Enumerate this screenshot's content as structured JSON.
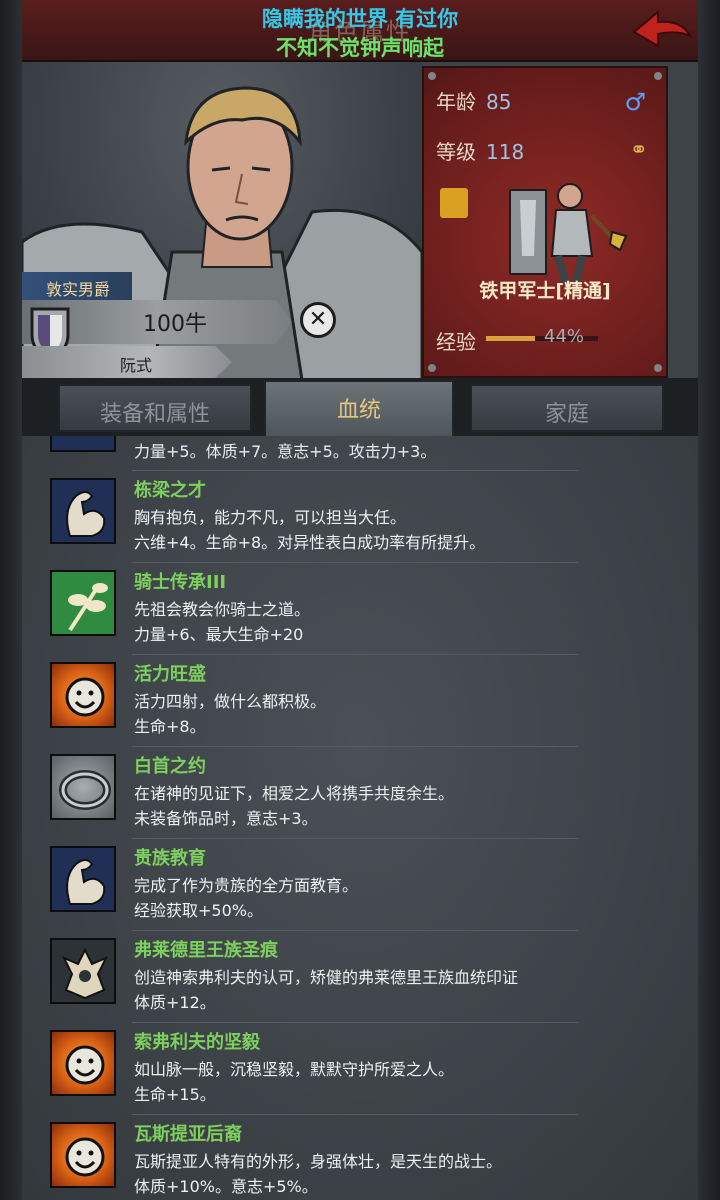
{
  "header": {
    "title": "角色属性",
    "overlay_line1": "隐瞒我的世界 有过你",
    "overlay_line2": "不知不觉钟声响起"
  },
  "character": {
    "title_badge": "敦实男爵",
    "wealth": "100牛",
    "house": "阮式"
  },
  "stats": {
    "age_label": "年龄",
    "age_value": "85",
    "level_label": "等级",
    "level_value": "118",
    "class_name": "铁甲军士[精通]",
    "exp_label": "经验",
    "exp_percent": "44%",
    "exp_fraction": 0.44
  },
  "tabs": [
    {
      "label": "装备和属性",
      "active": false
    },
    {
      "label": "血统",
      "active": true
    },
    {
      "label": "家庭",
      "active": false
    }
  ],
  "partial_trait": "力量+5。体质+7。意志+5。攻击力+3。",
  "traits": [
    {
      "name": "栋梁之才",
      "icon": "flexed-arm-icon",
      "desc1": "胸有抱负，能力不凡，可以担当大任。",
      "desc2": "六维+4。生命+8。对异性表白成功率有所提升。"
    },
    {
      "name": "骑士传承III",
      "icon": "leaf-branch-icon",
      "desc1": "先祖会教会你骑士之道。",
      "desc2": "力量+6、最大生命+20"
    },
    {
      "name": "活力旺盛",
      "icon": "smiley-sun-icon",
      "desc1": "活力四射，做什么都积极。",
      "desc2": "生命+8。"
    },
    {
      "name": "白首之约",
      "icon": "ring-icon",
      "desc1": "在诸神的见证下，相爱之人将携手共度余生。",
      "desc2": "未装备饰品时，意志+3。"
    },
    {
      "name": "贵族教育",
      "icon": "flexed-arm-icon",
      "desc1": "完成了作为贵族的全方面教育。",
      "desc2": "经验获取+50%。"
    },
    {
      "name": "弗莱德里王族圣痕",
      "icon": "crest-icon",
      "desc1": "创造神索弗利夫的认可，矫健的弗莱德里王族血统印证",
      "desc2": "体质+12。"
    },
    {
      "name": "索弗利夫的坚毅",
      "icon": "smiley-sun-icon",
      "desc1": "如山脉一般，沉稳坚毅，默默守护所爱之人。",
      "desc2": "生命+15。"
    },
    {
      "name": "瓦斯提亚后裔",
      "icon": "smiley-sun-icon",
      "desc1": "瓦斯提亚人特有的外形，身强体壮，是天生的战士。",
      "desc2": "体质+10%。意志+5%。"
    }
  ]
}
